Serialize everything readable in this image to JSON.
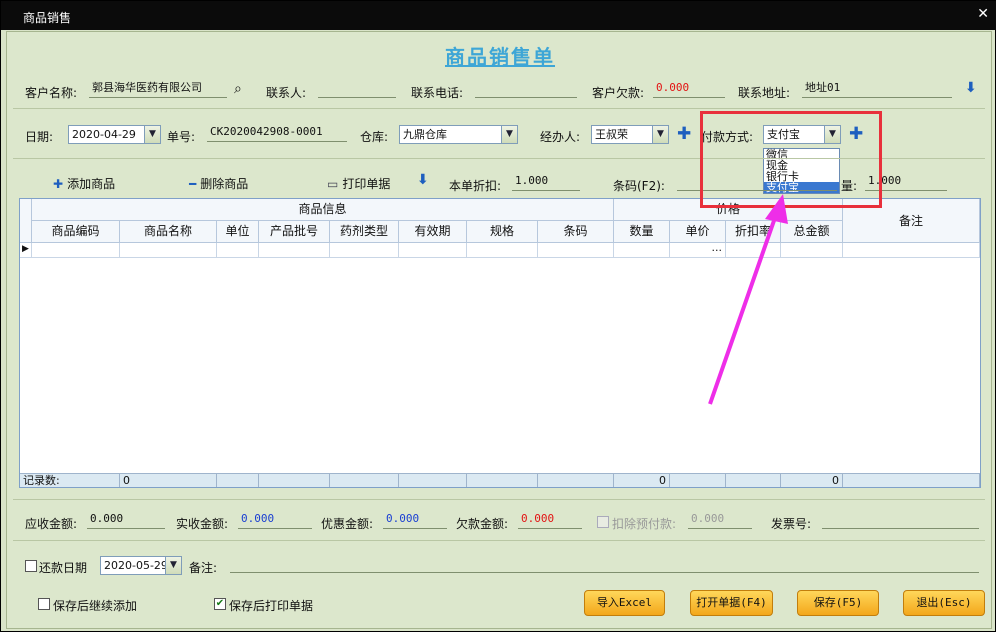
{
  "window": {
    "title": "商品销售"
  },
  "form_title": "商品销售单",
  "row1": {
    "customer_label": "客户名称:",
    "customer_value": "郭县海华医药有限公司",
    "contact_label": "联系人:",
    "contact_value": "",
    "phone_label": "联系电话:",
    "phone_value": "",
    "debt_label": "客户欠款:",
    "debt_value": "0.000",
    "address_label": "联系地址:",
    "address_value": "地址01"
  },
  "row2": {
    "date_label": "日期:",
    "date_value": "2020-04-29",
    "order_label": "单号:",
    "order_value": "CK2020042908-0001",
    "warehouse_label": "仓库:",
    "warehouse_value": "九鼎仓库",
    "handler_label": "经办人:",
    "handler_value": "王叔荣",
    "payment_label": "付款方式:",
    "payment_value": "支付宝",
    "payment_options": [
      "微信",
      "现金",
      "银行卡",
      "支付宝"
    ]
  },
  "toolbar": {
    "add_label": "添加商品",
    "delete_label": "删除商品",
    "print_label": "打印单据",
    "discount_label": "本单折扣:",
    "discount_value": "1.000",
    "barcode_label": "条码(F2):",
    "qty_label": "量:",
    "qty_value": "1.000"
  },
  "grid": {
    "group_goods": "商品信息",
    "group_price": "价格",
    "remark": "备注",
    "columns": [
      "商品编码",
      "商品名称",
      "单位",
      "产品批号",
      "药剂类型",
      "有效期",
      "规格",
      "条码",
      "数量",
      "单价",
      "折扣率",
      "总金额"
    ],
    "ellipsis": "...",
    "footer_label": "记录数:",
    "footer_count": "0",
    "footer_qty": "0",
    "footer_total": "0"
  },
  "totals": {
    "receivable_label": "应收金额:",
    "receivable_value": "0.000",
    "received_label": "实收金额:",
    "received_value": "0.000",
    "discount_label": "优惠金额:",
    "discount_value": "0.000",
    "debt_label": "欠款金额:",
    "debt_value": "0.000",
    "prepay_label": "扣除预付款:",
    "prepay_value": "0.000",
    "invoice_label": "发票号:",
    "invoice_value": ""
  },
  "bottom": {
    "repay_label": "还款日期",
    "repay_date": "2020-05-29",
    "remark_label": "备注:",
    "continue_label": "保存后继续添加",
    "print_after_label": "保存后打印单据"
  },
  "buttons": {
    "import": "导入Excel",
    "open": "打开单据(F4)",
    "save": "保存(F5)",
    "exit": "退出(Esc)"
  },
  "colors": {
    "title": "#3ea6d6",
    "annotation_box": "#e8303b",
    "annotation_arrow": "#ee2ee8"
  }
}
